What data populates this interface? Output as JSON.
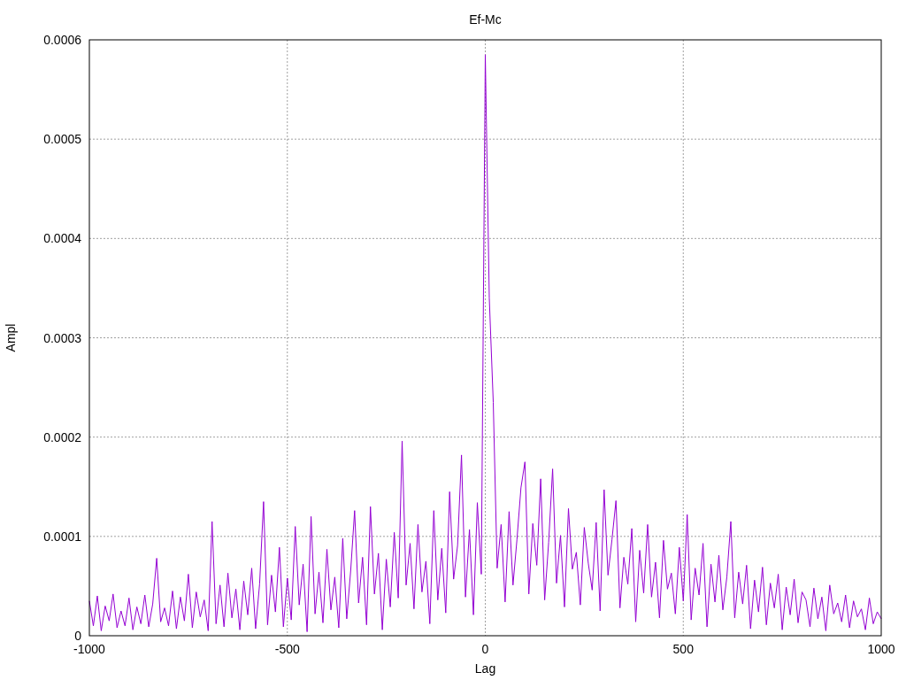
{
  "chart_data": {
    "type": "line",
    "title": "Ef-Mc",
    "xlabel": "Lag",
    "ylabel": "Ampl",
    "xlim": [
      -1000,
      1000
    ],
    "ylim": [
      0,
      0.0006
    ],
    "xticks": [
      -1000,
      -500,
      0,
      500,
      1000
    ],
    "yticks": [
      {
        "value": 0,
        "label": "0"
      },
      {
        "value": 0.0001,
        "label": "0.0001"
      },
      {
        "value": 0.0002,
        "label": "0.0002"
      },
      {
        "value": 0.0003,
        "label": "0.0003"
      },
      {
        "value": 0.0004,
        "label": "0.0004"
      },
      {
        "value": 0.0005,
        "label": "0.0005"
      },
      {
        "value": 0.0006,
        "label": "0.0006"
      }
    ],
    "x": [
      -1000,
      -990,
      -980,
      -970,
      -960,
      -950,
      -940,
      -930,
      -920,
      -910,
      -900,
      -890,
      -880,
      -870,
      -860,
      -850,
      -840,
      -830,
      -820,
      -810,
      -800,
      -790,
      -780,
      -770,
      -760,
      -750,
      -740,
      -730,
      -720,
      -710,
      -700,
      -690,
      -680,
      -670,
      -660,
      -650,
      -640,
      -630,
      -620,
      -610,
      -600,
      -590,
      -580,
      -570,
      -560,
      -550,
      -540,
      -530,
      -520,
      -510,
      -500,
      -490,
      -480,
      -470,
      -460,
      -450,
      -440,
      -430,
      -420,
      -410,
      -400,
      -390,
      -380,
      -370,
      -360,
      -350,
      -340,
      -330,
      -320,
      -310,
      -300,
      -290,
      -280,
      -270,
      -260,
      -250,
      -240,
      -230,
      -220,
      -210,
      -200,
      -190,
      -180,
      -170,
      -160,
      -150,
      -140,
      -130,
      -120,
      -110,
      -100,
      -90,
      -80,
      -70,
      -60,
      -50,
      -40,
      -30,
      -20,
      -10,
      0,
      10,
      20,
      30,
      40,
      50,
      60,
      70,
      80,
      90,
      100,
      110,
      120,
      130,
      140,
      150,
      160,
      170,
      180,
      190,
      200,
      210,
      220,
      230,
      240,
      250,
      260,
      270,
      280,
      290,
      300,
      310,
      320,
      330,
      340,
      350,
      360,
      370,
      380,
      390,
      400,
      410,
      420,
      430,
      440,
      450,
      460,
      470,
      480,
      490,
      500,
      510,
      520,
      530,
      540,
      550,
      560,
      570,
      580,
      590,
      600,
      610,
      620,
      630,
      640,
      650,
      660,
      670,
      680,
      690,
      700,
      710,
      720,
      730,
      740,
      750,
      760,
      770,
      780,
      790,
      800,
      810,
      820,
      830,
      840,
      850,
      860,
      870,
      880,
      890,
      900,
      910,
      920,
      930,
      940,
      950,
      960,
      970,
      980,
      990,
      1000
    ],
    "grid": true,
    "series": [
      {
        "color": "#9400d3",
        "values": [
          3.5e-05,
          1e-05,
          4e-05,
          5e-06,
          3e-05,
          1.5e-05,
          4.2e-05,
          8e-06,
          2.5e-05,
          1e-05,
          3.8e-05,
          6e-06,
          2.9e-05,
          1.2e-05,
          4.1e-05,
          9e-06,
          3.2e-05,
          7.8e-05,
          1.4e-05,
          2.8e-05,
          1e-05,
          4.5e-05,
          7e-06,
          3.9e-05,
          1.5e-05,
          6.2e-05,
          8e-06,
          4.4e-05,
          1.9e-05,
          3.6e-05,
          5e-06,
          0.000115,
          1.2e-05,
          5.1e-05,
          9e-06,
          6.3e-05,
          1.8e-05,
          4.7e-05,
          6e-06,
          5.5e-05,
          2.1e-05,
          6.8e-05,
          7e-06,
          5.2e-05,
          0.000135,
          1.1e-05,
          6.1e-05,
          2.4e-05,
          8.9e-05,
          9e-06,
          5.8e-05,
          1.6e-05,
          0.00011,
          3.1e-05,
          7.2e-05,
          4e-06,
          0.00012,
          2.2e-05,
          6.4e-05,
          1.3e-05,
          8.7e-05,
          2.6e-05,
          5.9e-05,
          8e-06,
          9.8e-05,
          1.7e-05,
          6.6e-05,
          0.000126,
          3.3e-05,
          7.9e-05,
          1.1e-05,
          0.00013,
          4.2e-05,
          8.3e-05,
          6e-06,
          7.7e-05,
          2.9e-05,
          0.000104,
          3.8e-05,
          0.000196,
          5.1e-05,
          9.3e-05,
          2.7e-05,
          0.000112,
          4.4e-05,
          7.5e-05,
          1.2e-05,
          0.000126,
          3.6e-05,
          8.8e-05,
          2.3e-05,
          0.000145,
          5.7e-05,
          9.1e-05,
          0.000182,
          3.9e-05,
          0.000107,
          2.1e-05,
          0.000134,
          6.2e-05,
          0.000585,
          0.00034,
          0.000235,
          6.8e-05,
          0.000112,
          3.4e-05,
          0.000125,
          5.1e-05,
          9.7e-05,
          0.000149,
          0.000175,
          4.2e-05,
          0.000113,
          7.1e-05,
          0.000158,
          3.6e-05,
          9.4e-05,
          0.000168,
          5.3e-05,
          0.000101,
          2.9e-05,
          0.000128,
          6.7e-05,
          8.4e-05,
          3.1e-05,
          0.000109,
          7.3e-05,
          4.6e-05,
          0.000114,
          2.5e-05,
          0.000147,
          6.1e-05,
          9.7e-05,
          0.000136,
          2.8e-05,
          7.9e-05,
          5.2e-05,
          0.000108,
          1.4e-05,
          8.6e-05,
          4.3e-05,
          0.000112,
          3.9e-05,
          7.4e-05,
          1.8e-05,
          9.6e-05,
          4.7e-05,
          6.3e-05,
          2.2e-05,
          8.9e-05,
          3.5e-05,
          0.000122,
          1.6e-05,
          6.8e-05,
          4.1e-05,
          9.3e-05,
          9e-06,
          7.2e-05,
          3.4e-05,
          8.1e-05,
          2.6e-05,
          5.9e-05,
          0.000115,
          1.8e-05,
          6.4e-05,
          3.2e-05,
          7.1e-05,
          7e-06,
          5.6e-05,
          2.4e-05,
          6.9e-05,
          1.1e-05,
          5.3e-05,
          2.8e-05,
          6.2e-05,
          6e-06,
          4.9e-05,
          2.1e-05,
          5.7e-05,
          1.3e-05,
          4.4e-05,
          3.6e-05,
          9e-06,
          4.8e-05,
          1.7e-05,
          3.9e-05,
          5e-06,
          5.1e-05,
          2.2e-05,
          3.3e-05,
          1.4e-05,
          4.1e-05,
          8e-06,
          3.5e-05,
          1.9e-05,
          2.7e-05,
          6e-06,
          3.8e-05,
          1.2e-05,
          2.4e-05,
          1.7e-05
        ]
      }
    ]
  }
}
